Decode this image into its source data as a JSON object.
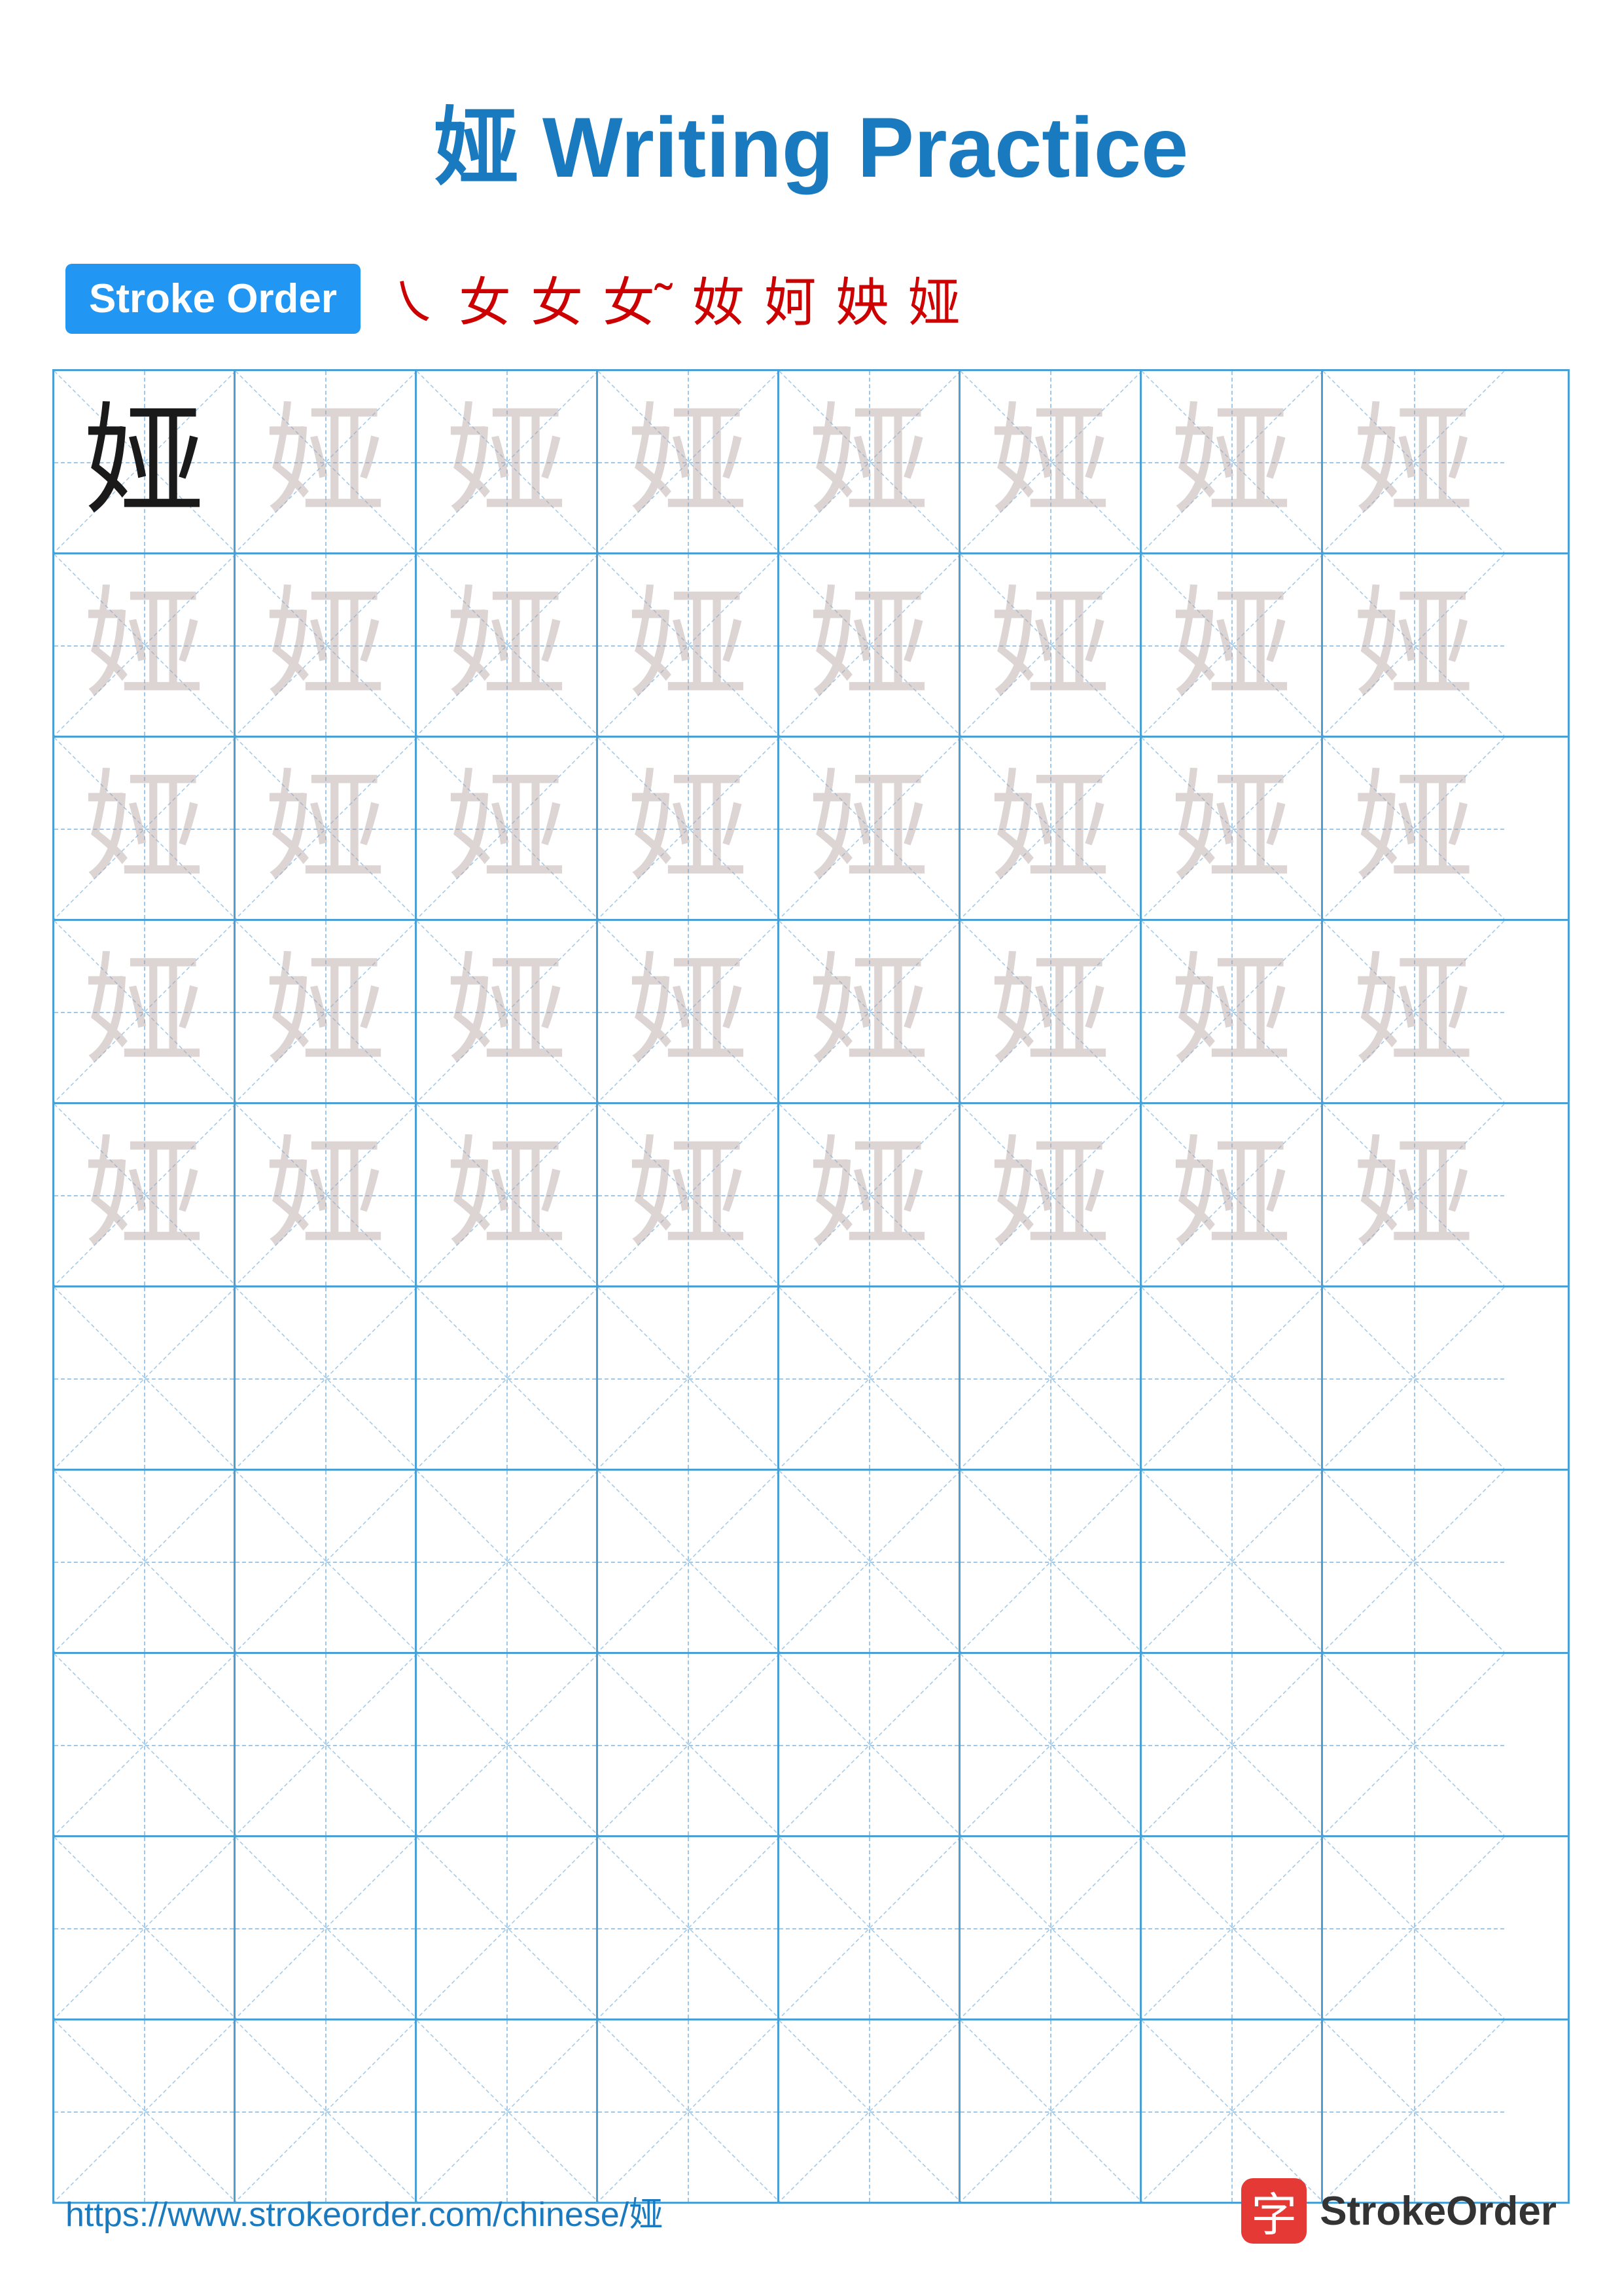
{
  "title": {
    "char": "娅",
    "text": "Writing Practice",
    "full": "娅 Writing Practice"
  },
  "stroke_order": {
    "badge": "Stroke Order",
    "strokes": [
      "㇏",
      "女",
      "女",
      "女˜",
      "奻",
      "妸",
      "姎",
      "娅"
    ]
  },
  "grid": {
    "rows": 10,
    "cols": 8,
    "char": "娅",
    "filled_rows": 5,
    "empty_rows": 5
  },
  "footer": {
    "url": "https://www.strokeorder.com/chinese/娅",
    "logo_text": "StrokeOrder",
    "logo_char": "字"
  }
}
